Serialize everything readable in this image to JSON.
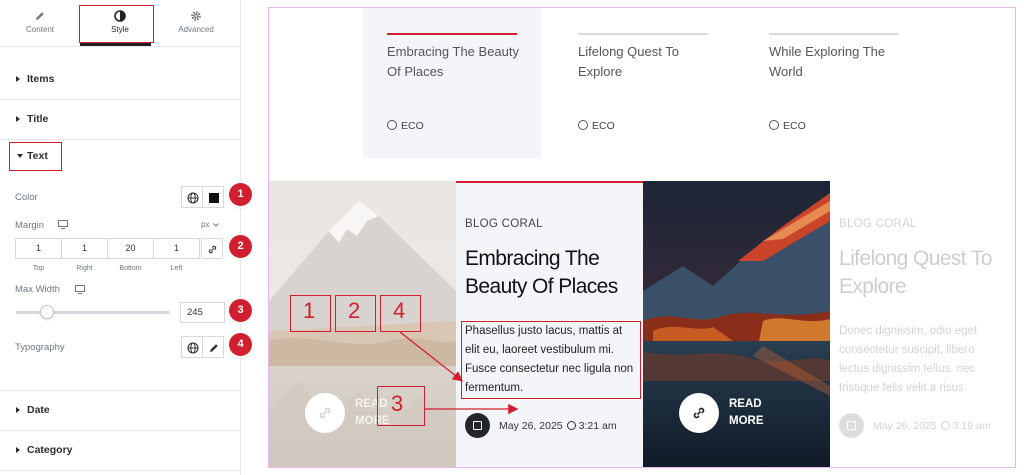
{
  "panel": {
    "tabs": [
      {
        "label": "Content",
        "icon": "pencil-icon"
      },
      {
        "label": "Style",
        "icon": "half-circle-icon"
      },
      {
        "label": "Advanced",
        "icon": "gear-icon"
      }
    ],
    "sections_top": [
      "Items",
      "Title"
    ],
    "text_section": "Text",
    "color_label": "Color",
    "margin_label": "Margin",
    "margin_unit": "px",
    "margin_values": [
      "1",
      "1",
      "20",
      "1"
    ],
    "margin_captions": [
      "Top",
      "Right",
      "Bottom",
      "Left"
    ],
    "max_width_label": "Max Width",
    "max_width_value": "245",
    "max_width_fraction": 0.2,
    "typography_label": "Typography",
    "sections_bottom": [
      "Date",
      "Category"
    ],
    "badges": [
      "1",
      "2",
      "3",
      "4"
    ]
  },
  "preview": {
    "top_cards": [
      {
        "title": "Embracing The Beauty Of Places",
        "meta": "ECO",
        "active": true
      },
      {
        "title": "Lifelong Quest To Explore",
        "meta": "ECO",
        "active": false
      },
      {
        "title": "While Exploring The World",
        "meta": "ECO",
        "active": false
      }
    ],
    "read_more_left": [
      "READ",
      "MORE"
    ],
    "main_card": {
      "category": "BLOG CORAL",
      "title": "Embracing The Beauty Of Places",
      "text": "Phasellus justo lacus, mattis at elit eu, laoreet vestibulum mi. Fusce consectetur nec ligula non fermentum.",
      "date": "May 26, 2025",
      "time": "3:21 am"
    },
    "read_more_right": [
      "READ",
      "MORE"
    ],
    "faded_card": {
      "category": "BLOG CORAL",
      "title": "Lifelong Quest To Explore",
      "text": "Donec dignissim, odio eget consectetur suscipit, libero lectus dignissim tellus, nec tristique felis velit a risus.",
      "date": "May 26, 2025",
      "time": "3:19 am"
    },
    "annotations": [
      "1",
      "2",
      "4",
      "3"
    ]
  },
  "colors": {
    "accent": "#d21f2f",
    "annotation_border": "#e9b7ee"
  }
}
